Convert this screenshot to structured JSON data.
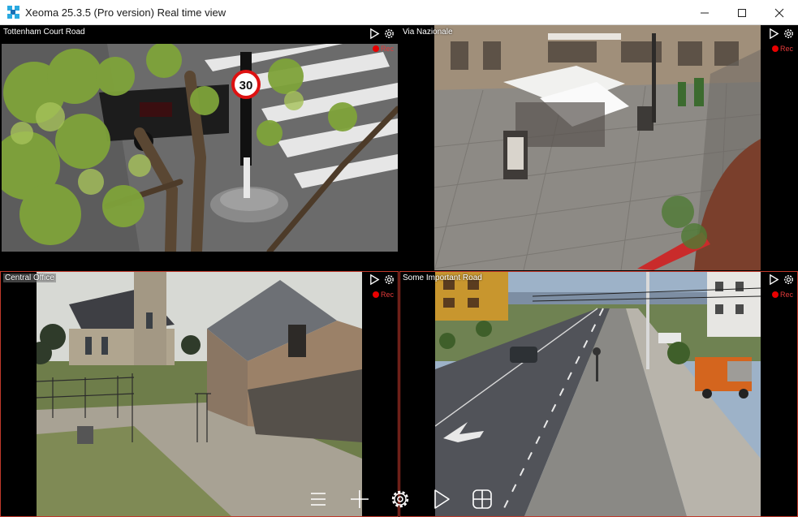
{
  "window": {
    "title": "Xeoma 25.3.5 (Pro version) Real time view",
    "icon": "xeoma-app-icon",
    "controls": [
      "minimize-icon",
      "maximize-icon",
      "close-icon"
    ]
  },
  "cameras": [
    {
      "name": "Tottenham Court Road",
      "rec_label": "Rec",
      "scene": "street-tree-sign",
      "selected": false
    },
    {
      "name": "Via Nazionale",
      "rec_label": "Rec",
      "scene": "piazza-cafe",
      "selected": false
    },
    {
      "name": "Central Office",
      "rec_label": "Rec",
      "scene": "church-barn",
      "selected": true
    },
    {
      "name": "Some Important Road",
      "rec_label": "Rec",
      "scene": "highway-truck",
      "selected": true
    }
  ],
  "sign": {
    "speed_limit": "30"
  },
  "toolbar": {
    "items": [
      "menu-icon",
      "add-icon",
      "settings-icon",
      "play-icon",
      "layout-grid-icon"
    ]
  },
  "colors": {
    "rec": "#e80000",
    "selection": "#c0392b",
    "toolbar_icon": "#ffffff"
  }
}
